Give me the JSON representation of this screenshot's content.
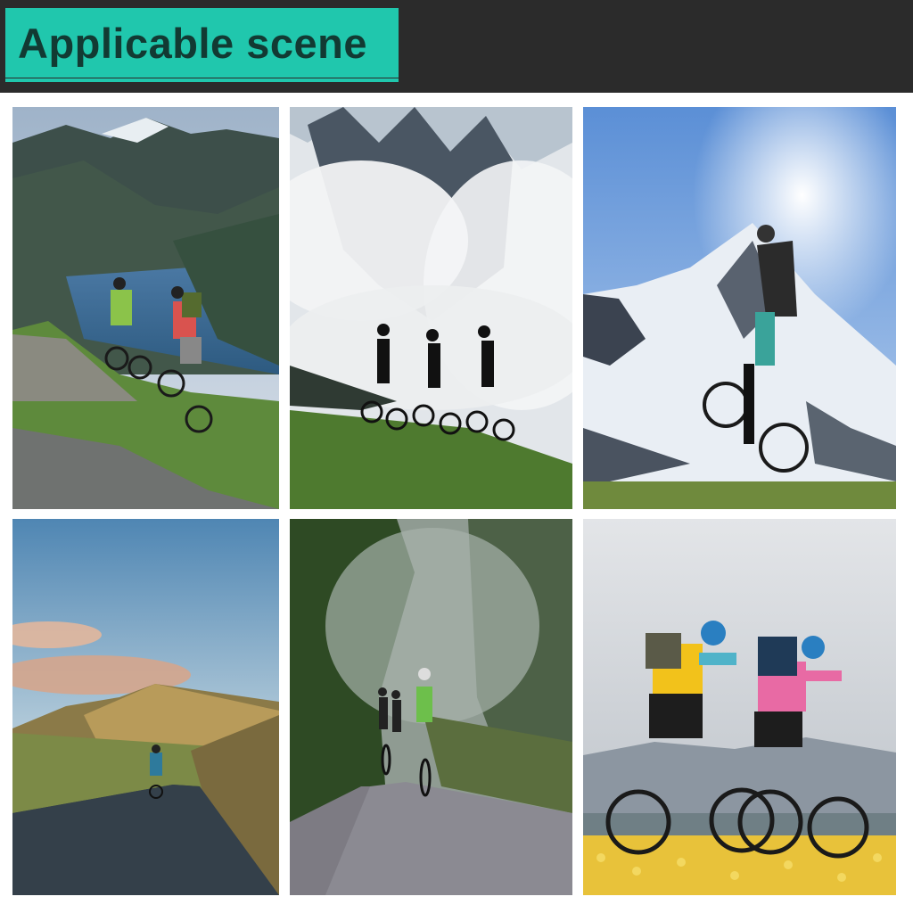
{
  "banner": {
    "title": "Applicable scene"
  },
  "colors": {
    "header_background": "#2b2b2b",
    "title_box": "#20c7ad",
    "title_text": "#123a33"
  },
  "scenes": [
    {
      "name": "scene-lake-valley-riders"
    },
    {
      "name": "scene-misty-mountain-silhouettes"
    },
    {
      "name": "scene-snowy-peak-rider"
    },
    {
      "name": "scene-sunset-road-rider"
    },
    {
      "name": "scene-forest-road-group"
    },
    {
      "name": "scene-flower-field-couple"
    }
  ]
}
